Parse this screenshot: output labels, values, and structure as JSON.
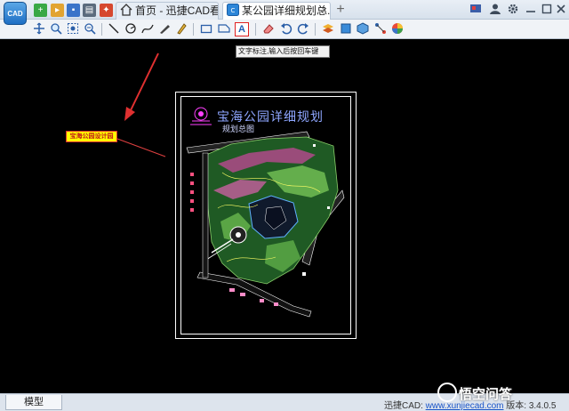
{
  "app": {
    "logo_text": "CAD",
    "accent": "#1f6fc4"
  },
  "tabs": [
    {
      "label": "首页 - 迅捷CAD看图",
      "icon": "home-icon"
    },
    {
      "label": "某公园详细规划总...",
      "icon": "cad-file-icon",
      "close": "×"
    }
  ],
  "tab_add": "+",
  "toolbar": {
    "text_tool_glyph": "A",
    "tooltip": "文字标注,输入后按回车键"
  },
  "drawing": {
    "title": "宝海公园详细规划",
    "subtitle": "规划总图",
    "annotation_label": "宝海公园设计园",
    "annotation_color": "#ffff00",
    "arrow_color": "#e03030"
  },
  "statusbar": {
    "model_tab": "模型",
    "product_prefix": "迅捷CAD: ",
    "website": "www.xunjiecad.com",
    "version_label": " 版本: 3.4.0.5"
  },
  "watermark": "悟空问答"
}
